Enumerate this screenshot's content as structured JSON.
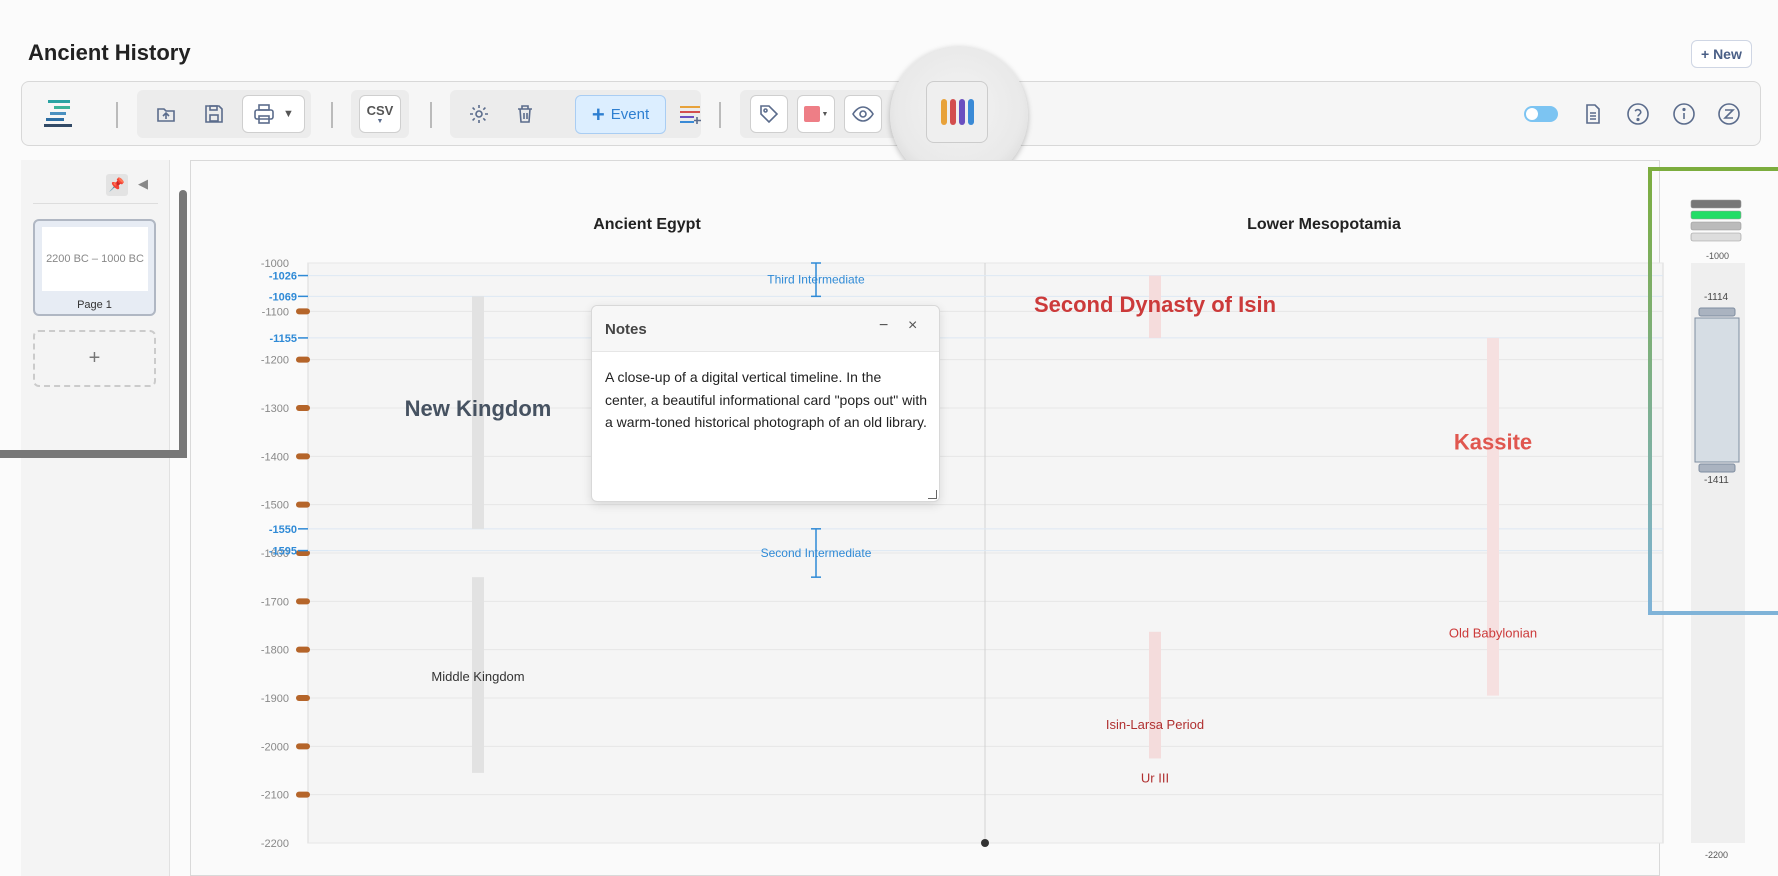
{
  "header": {
    "title": "Ancient History",
    "new_label": "+ New"
  },
  "toolbar": {
    "csv_label": "CSV",
    "event_label": "Event",
    "event_plus": "+"
  },
  "sidebar": {
    "page_range": "2200 BC – 1000 BC",
    "page_label": "Page 1",
    "add_label": "+"
  },
  "notes": {
    "title": "Notes",
    "minimize": "−",
    "close": "×",
    "body": "A close-up of a digital vertical timeline. In the center, a beautiful informational card \"pops out\" with a warm-toned historical photograph of an old library."
  },
  "minimap": {
    "top": "-1000",
    "sel_top": "-1114",
    "sel_bottom": "-1411",
    "bottom": "-2200"
  },
  "colors": {
    "egypt": "#444444",
    "mesopotamia": "#cc3333",
    "intermediate": "#2f8ad6",
    "pin": "#b5652a"
  },
  "chart_data": {
    "type": "timeline",
    "columns": [
      "Ancient Egypt",
      "Lower Mesopotamia"
    ],
    "y_range": [
      -2200,
      -1000
    ],
    "y_ticks": [
      "-1000",
      "-1100",
      "-1200",
      "-1300",
      "-1400",
      "-1500",
      "-1600",
      "-1700",
      "-1800",
      "-1900",
      "-2000",
      "-2100",
      "-2200"
    ],
    "marker_ticks": [
      "-1026",
      "-1069",
      "-1155",
      "-1550",
      "-1595"
    ],
    "periods": [
      {
        "name": "New Kingdom",
        "column": 0,
        "start": -1550,
        "end": -1069
      },
      {
        "name": "Middle Kingdom",
        "column": 0,
        "start": -2055,
        "end": -1650
      },
      {
        "name": "Second Dynasty of Isin",
        "column": 1,
        "start": -1155,
        "end": -1026
      },
      {
        "name": "Kassite",
        "column": 1,
        "start": -1895,
        "end": -1155
      },
      {
        "name": "Old Babylonian",
        "column": 1,
        "start": -1895,
        "end": -1595
      },
      {
        "name": "Isin-Larsa Period",
        "column": 1,
        "start": -2025,
        "end": -1763
      },
      {
        "name": "Ur III",
        "column": 1,
        "start": -2112,
        "end": -2004
      }
    ],
    "intermediates": [
      {
        "name": "Third Intermediate",
        "start": -1069,
        "end": -1000
      },
      {
        "name": "Second Intermediate",
        "start": -1650,
        "end": -1550
      }
    ]
  }
}
